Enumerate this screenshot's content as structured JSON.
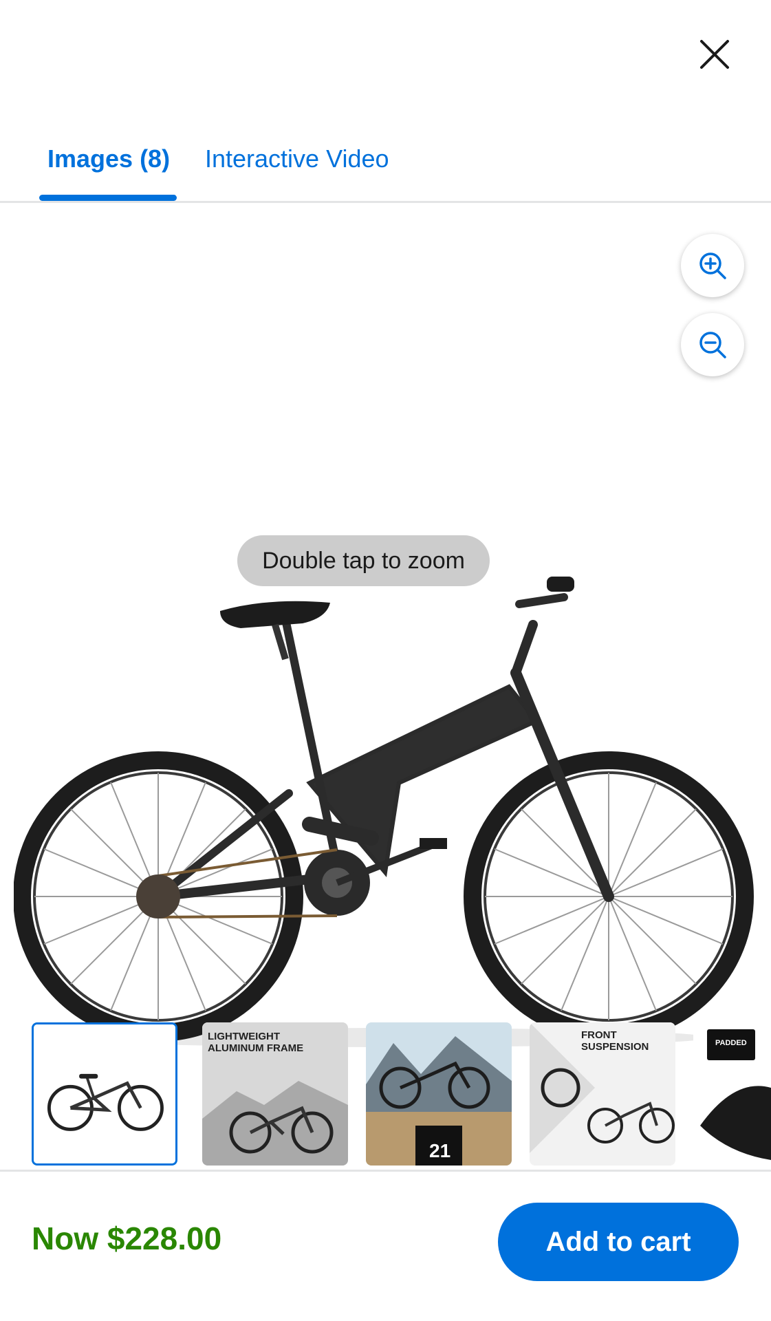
{
  "header": {
    "close_icon": "close-icon"
  },
  "tabs": [
    {
      "label": "Images (8)",
      "active": true
    },
    {
      "label": "Interactive Video",
      "active": false
    }
  ],
  "viewer": {
    "zoom_in_icon": "zoom-in-icon",
    "zoom_out_icon": "zoom-out-icon",
    "hint": "Double tap to zoom",
    "image": "black full-suspension mountain bike"
  },
  "thumbnails": [
    {
      "caption": "",
      "selected": true
    },
    {
      "caption": "LIGHTWEIGHT ALUMINUM FRAME",
      "selected": false
    },
    {
      "caption": "21",
      "selected": false
    },
    {
      "caption": "FRONT SUSPENSION",
      "selected": false
    },
    {
      "caption": "PADDED",
      "selected": false
    }
  ],
  "footer": {
    "price": "Now $228.00",
    "add_to_cart": "Add to cart"
  },
  "colors": {
    "accent": "#0071dc",
    "price": "#2a8703",
    "divider": "#e3e4e5"
  }
}
